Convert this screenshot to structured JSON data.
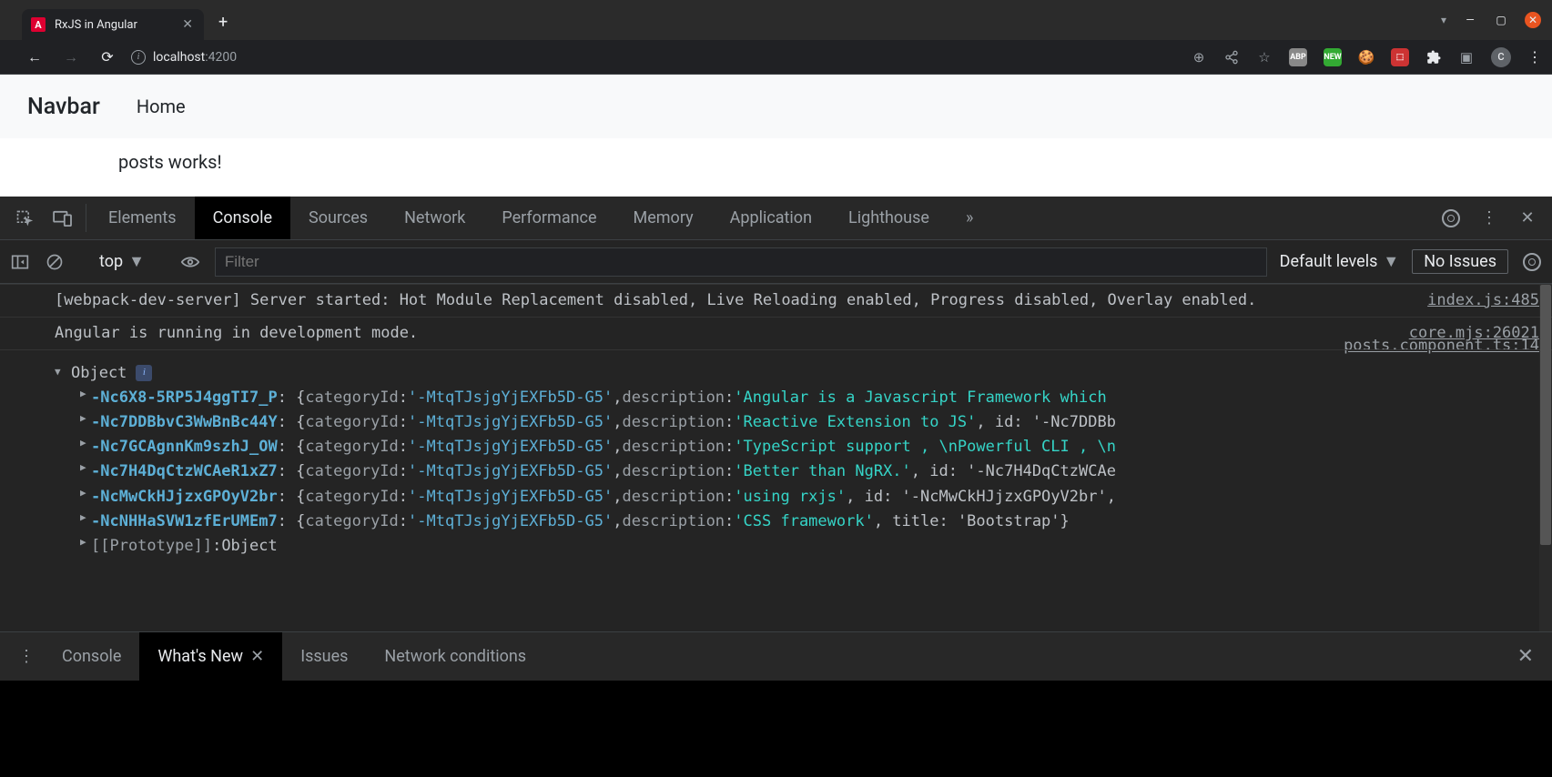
{
  "browser": {
    "tab_title": "RxJS in Angular",
    "url_host": "localhost",
    "url_port": ":4200",
    "avatar_initial": "C"
  },
  "page": {
    "brand": "Navbar",
    "nav_link": "Home",
    "content": "posts works!"
  },
  "devtools": {
    "panels": [
      "Elements",
      "Console",
      "Sources",
      "Network",
      "Performance",
      "Memory",
      "Application",
      "Lighthouse"
    ],
    "active_panel": "Console"
  },
  "console": {
    "context": "top",
    "filter_placeholder": "Filter",
    "levels_label": "Default levels",
    "issues_label": "No Issues",
    "logs": [
      {
        "msg": "[webpack-dev-server] Server started: Hot Module Replacement disabled, Live Reloading enabled, Progress disabled, Overlay enabled.",
        "src": "index.js:485"
      },
      {
        "msg": "Angular is running in development mode.",
        "src": "core.mjs:26021"
      }
    ],
    "object_src": "posts.component.ts:14",
    "object_label": "Object",
    "prototype_label": "[[Prototype]]",
    "prototype_value": "Object",
    "entries": [
      {
        "key": "-Nc6X8-5RP5J4ggTI7_P",
        "categoryId": "'-MtqTJsjgYjEXFb5D-G5'",
        "description": "'Angular is a Javascript Framework which",
        "tail": ""
      },
      {
        "key": "-Nc7DDBbvC3WwBnBc44Y",
        "categoryId": "'-MtqTJsjgYjEXFb5D-G5'",
        "description": "'Reactive Extension to JS'",
        "tail": ", id: '-Nc7DDBb"
      },
      {
        "key": "-Nc7GCAgnnKm9szhJ_OW",
        "categoryId": "'-MtqTJsjgYjEXFb5D-G5'",
        "description": "'TypeScript support , \\nPowerful CLI , \\n",
        "tail": ""
      },
      {
        "key": "-Nc7H4DqCtzWCAeR1xZ7",
        "categoryId": "'-MtqTJsjgYjEXFb5D-G5'",
        "description": "'Better than NgRX.'",
        "tail": ", id: '-Nc7H4DqCtzWCAe"
      },
      {
        "key": "-NcMwCkHJjzxGPOyV2br",
        "categoryId": "'-MtqTJsjgYjEXFb5D-G5'",
        "description": "'using rxjs'",
        "tail": ", id: '-NcMwCkHJjzxGPOyV2br',"
      },
      {
        "key": "-NcNHHaSVW1zfErUMEm7",
        "categoryId": "'-MtqTJsjgYjEXFb5D-G5'",
        "description": "'CSS framework'",
        "tail": ", title: 'Bootstrap'}"
      }
    ]
  },
  "drawer": {
    "tabs": [
      "Console",
      "What's New",
      "Issues",
      "Network conditions"
    ],
    "active": "What's New"
  }
}
